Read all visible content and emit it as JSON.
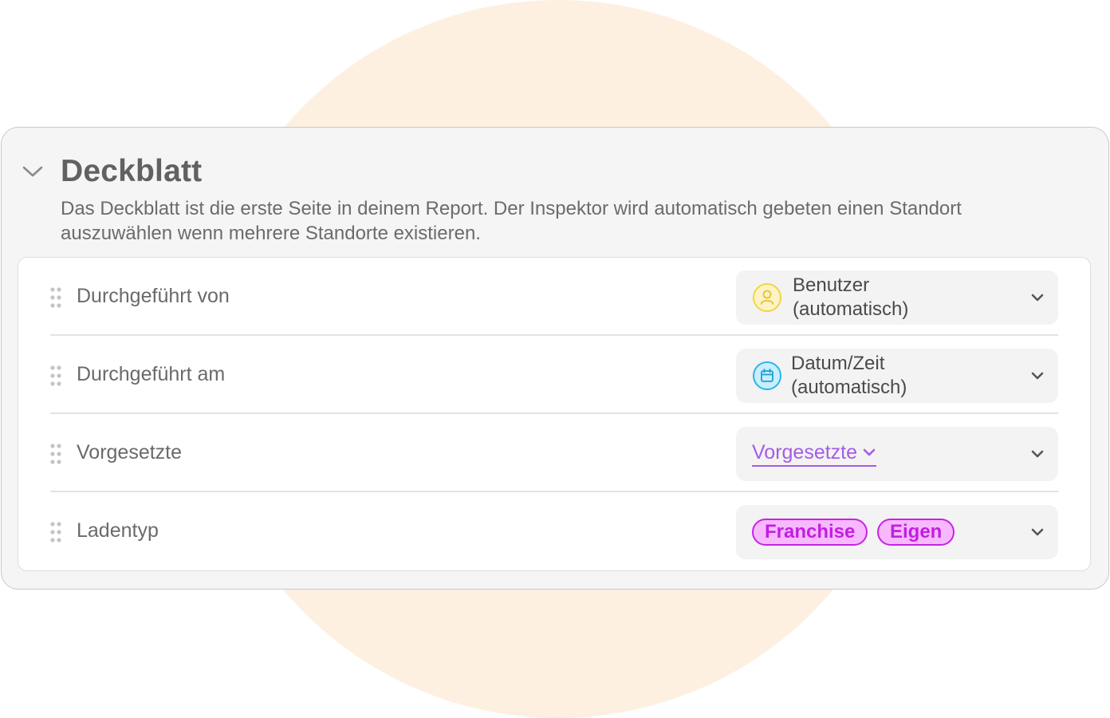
{
  "section": {
    "title": "Deckblatt",
    "description": "Das Deckblatt ist die erste Seite in deinem Report. Der Inspektor wird automatisch gebeten einen Standort auszuwählen wenn mehrere Standorte existieren."
  },
  "rows": [
    {
      "label": "Durchgeführt von",
      "value_line1": "Benutzer",
      "value_line2": "(automatisch)",
      "icon": "user-icon",
      "icon_color": "#f5d440"
    },
    {
      "label": "Durchgeführt am",
      "value_line1": "Datum/Zeit",
      "value_line2": "(automatisch)",
      "icon": "calendar-icon",
      "icon_color": "#2bb5e8"
    },
    {
      "label": "Vorgesetzte",
      "value": "Vorgesetzte",
      "value_color": "#a55ce6"
    },
    {
      "label": "Ladentyp",
      "tags": [
        "Franchise",
        "Eigen"
      ],
      "tag_color": "#c822e6",
      "tag_bg": "#f8b8ff"
    }
  ],
  "colors": {
    "background_circle": "#fdf0e1",
    "card_bg": "#f5f5f5"
  }
}
